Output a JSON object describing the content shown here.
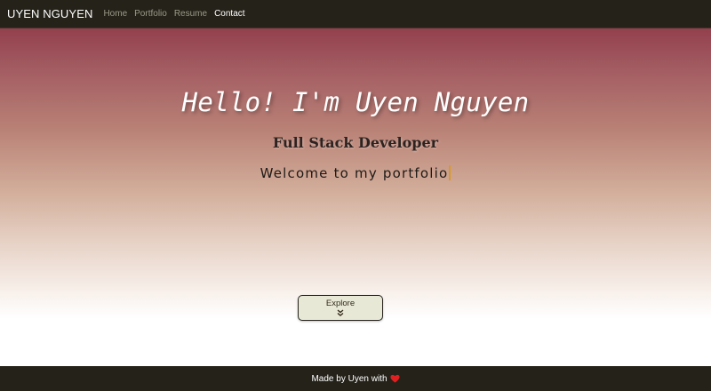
{
  "navbar": {
    "brand": "UYEN NGUYEN",
    "links": [
      {
        "label": "Home"
      },
      {
        "label": "Portfolio"
      },
      {
        "label": "Resume"
      },
      {
        "label": "Contact"
      }
    ]
  },
  "hero": {
    "title": "Hello! I'm Uyen Nguyen",
    "subtitle": "Full Stack Developer",
    "welcome": "Welcome to my portfolio",
    "explore_label": "Explore"
  },
  "footer": {
    "text": "Made by Uyen with",
    "heart_icon": "heart-icon"
  },
  "colors": {
    "navbar_bg": "#252219",
    "hero_top": "#93404d",
    "explore_bg": "#e8e8d6",
    "cursor": "#d79a2a",
    "heart": "#e02020"
  }
}
